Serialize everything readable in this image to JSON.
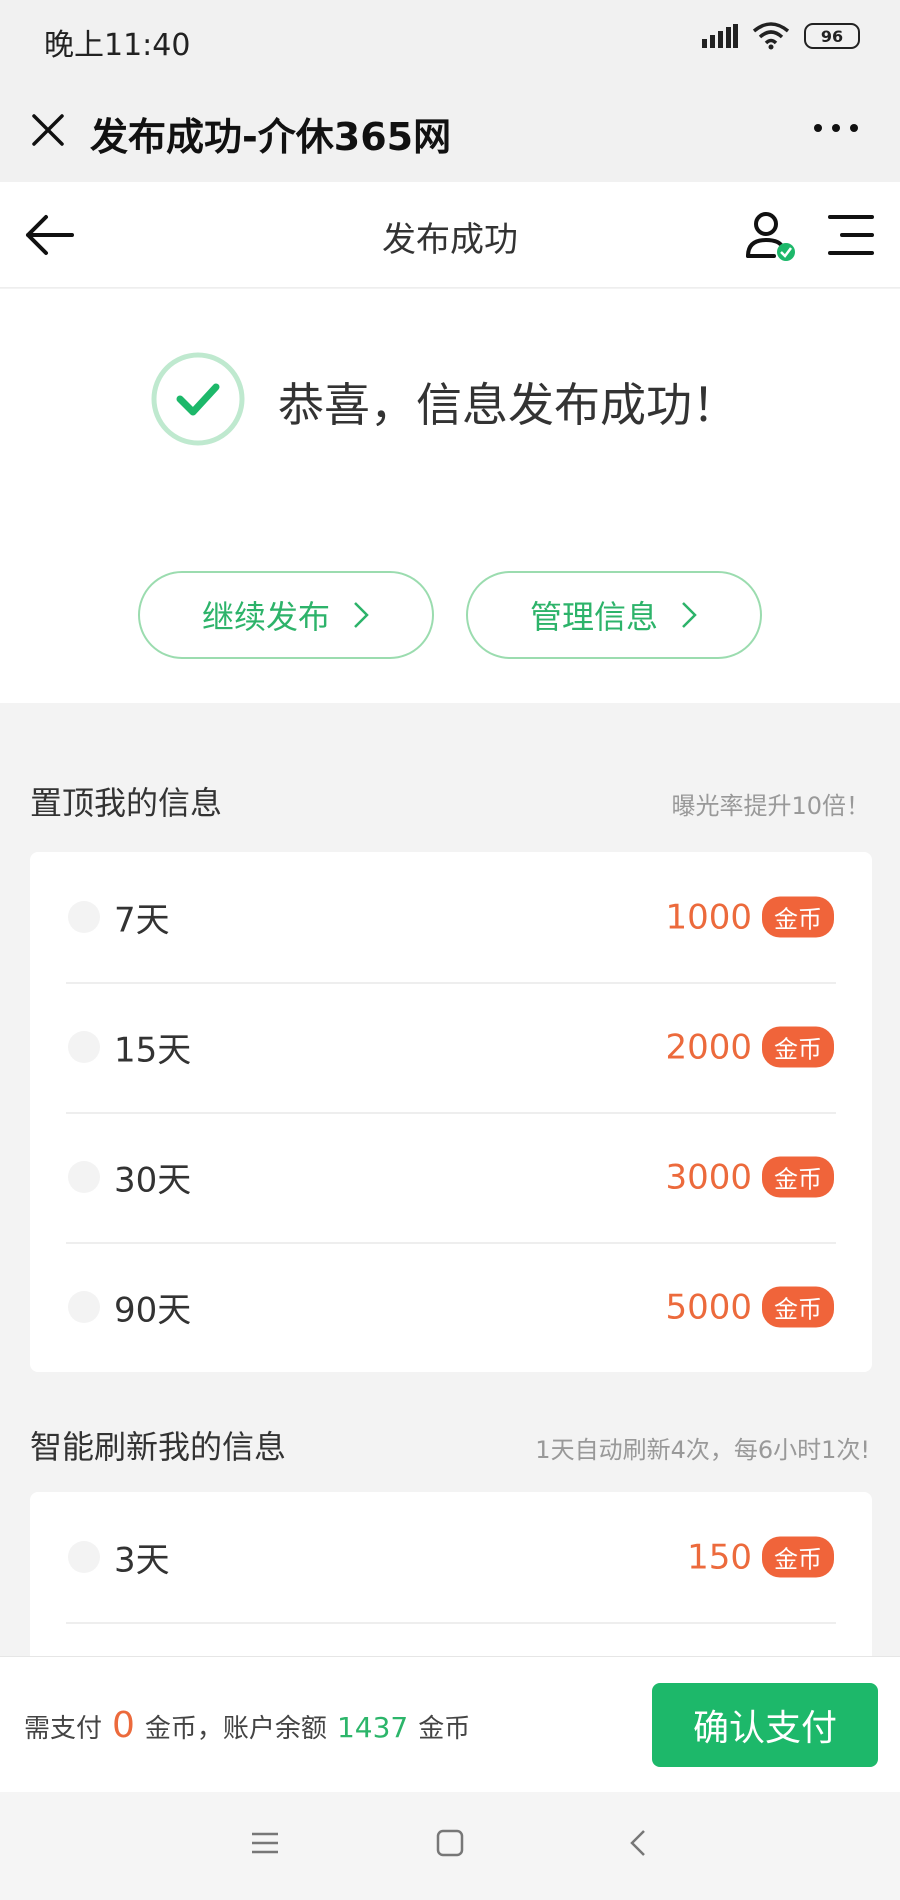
{
  "status_bar": {
    "time": "晚上11:40",
    "battery": "96"
  },
  "wechat_header": {
    "title": "发布成功-介休365网"
  },
  "nav": {
    "title": "发布成功"
  },
  "success": {
    "message": "恭喜，信息发布成功！",
    "continue_label": "继续发布",
    "manage_label": "管理信息"
  },
  "top_section": {
    "title": "置顶我的信息",
    "hint": "曝光率提升10倍！",
    "options": [
      {
        "label": "7天",
        "price": "1000",
        "unit": "金币"
      },
      {
        "label": "15天",
        "price": "2000",
        "unit": "金币"
      },
      {
        "label": "30天",
        "price": "3000",
        "unit": "金币"
      },
      {
        "label": "90天",
        "price": "5000",
        "unit": "金币"
      }
    ]
  },
  "refresh_section": {
    "title": "智能刷新我的信息",
    "hint": "1天自动刷新4次，每6小时1次!",
    "options": [
      {
        "label": "3天",
        "price": "150",
        "unit": "金币"
      }
    ]
  },
  "pay_bar": {
    "need_pay_label": "需支付",
    "amount": "0",
    "coin_label": "金币，账户余额",
    "balance": "1437",
    "coin_unit": "金币",
    "confirm_label": "确认支付"
  },
  "colors": {
    "accent_green": "#1db86a",
    "price_orange": "#ec6a3c"
  },
  "icons": [
    "close-icon",
    "more-icon",
    "back-arrow-icon",
    "user-verified-icon",
    "menu-icon",
    "check-circle-icon",
    "chevron-right-icon",
    "signal-icon",
    "wifi-icon"
  ]
}
